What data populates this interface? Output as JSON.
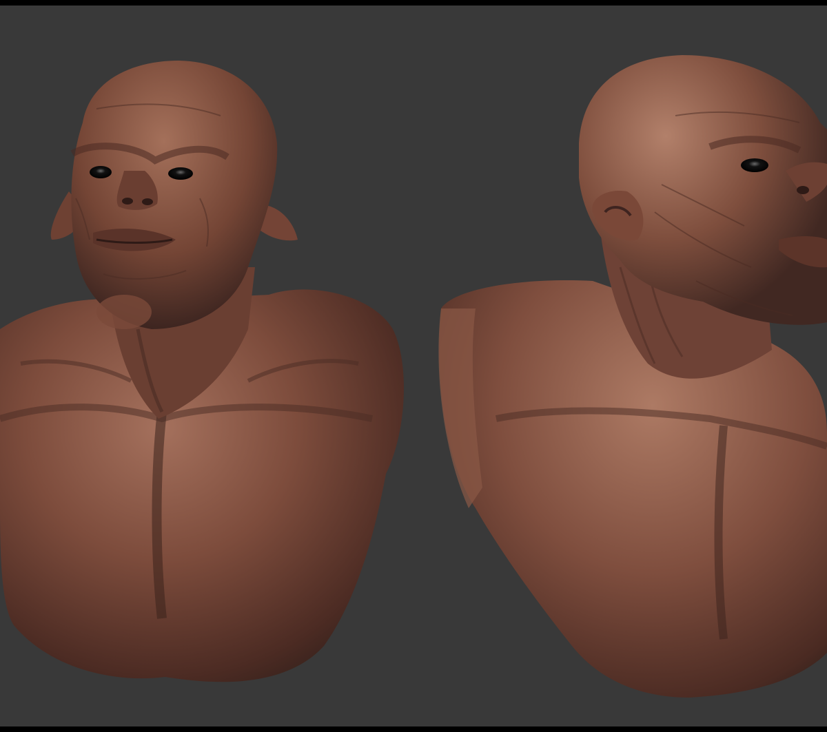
{
  "app": {
    "viewport_background": "#393939",
    "frame_border_color": "#000000"
  },
  "scene": {
    "description_colors": {
      "skin_base": "#7a4a3a",
      "skin_highlight": "#a0705c",
      "skin_shadow": "#3e2420"
    },
    "models": [
      {
        "name": "creature-bust-front-view"
      },
      {
        "name": "creature-bust-side-view"
      }
    ]
  }
}
